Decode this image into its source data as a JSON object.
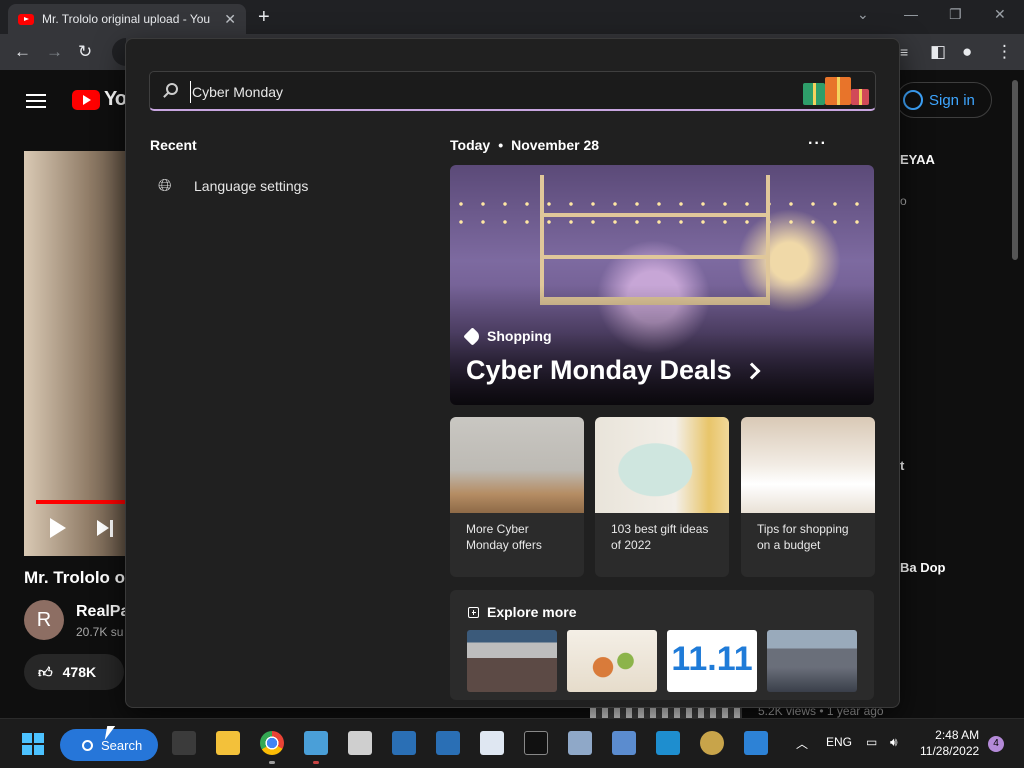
{
  "browser": {
    "tab_title": "Mr. Trololo original upload - You",
    "tab_close": "✕",
    "new_tab": "+"
  },
  "youtube": {
    "logo_text": "You",
    "sign_in": "Sign in",
    "video_title": "Mr. Trololo o",
    "channel_initial": "R",
    "channel_name": "RealPa",
    "subscribers": "20.7K su",
    "likes": "478K",
    "right_items": [
      "EYAA",
      "o",
      "t",
      "Ba Dop"
    ],
    "views_meta": "5.2K views  • 1 year ago"
  },
  "search": {
    "query": "Cyber Monday",
    "recent_heading": "Recent",
    "recent_items": [
      "Language settings"
    ],
    "today_label": "Today",
    "date": "November 28",
    "more": "···",
    "hero": {
      "category": "Shopping",
      "title": "Cyber Monday Deals"
    },
    "cards": [
      {
        "label": "More Cyber Monday offers"
      },
      {
        "label": "103 best gift ideas of 2022"
      },
      {
        "label": "Tips for shopping on a budget"
      }
    ],
    "explore_heading": "Explore more",
    "explore_thumb_text": "11.11"
  },
  "taskbar": {
    "search_label": "Search",
    "language": "ENG",
    "time": "2:48 AM",
    "date": "11/28/2022",
    "notification_count": "4"
  },
  "colors": {
    "accent": "#2676d9",
    "yt_red": "#ff0000",
    "search_underline": "#c8a6e0"
  }
}
